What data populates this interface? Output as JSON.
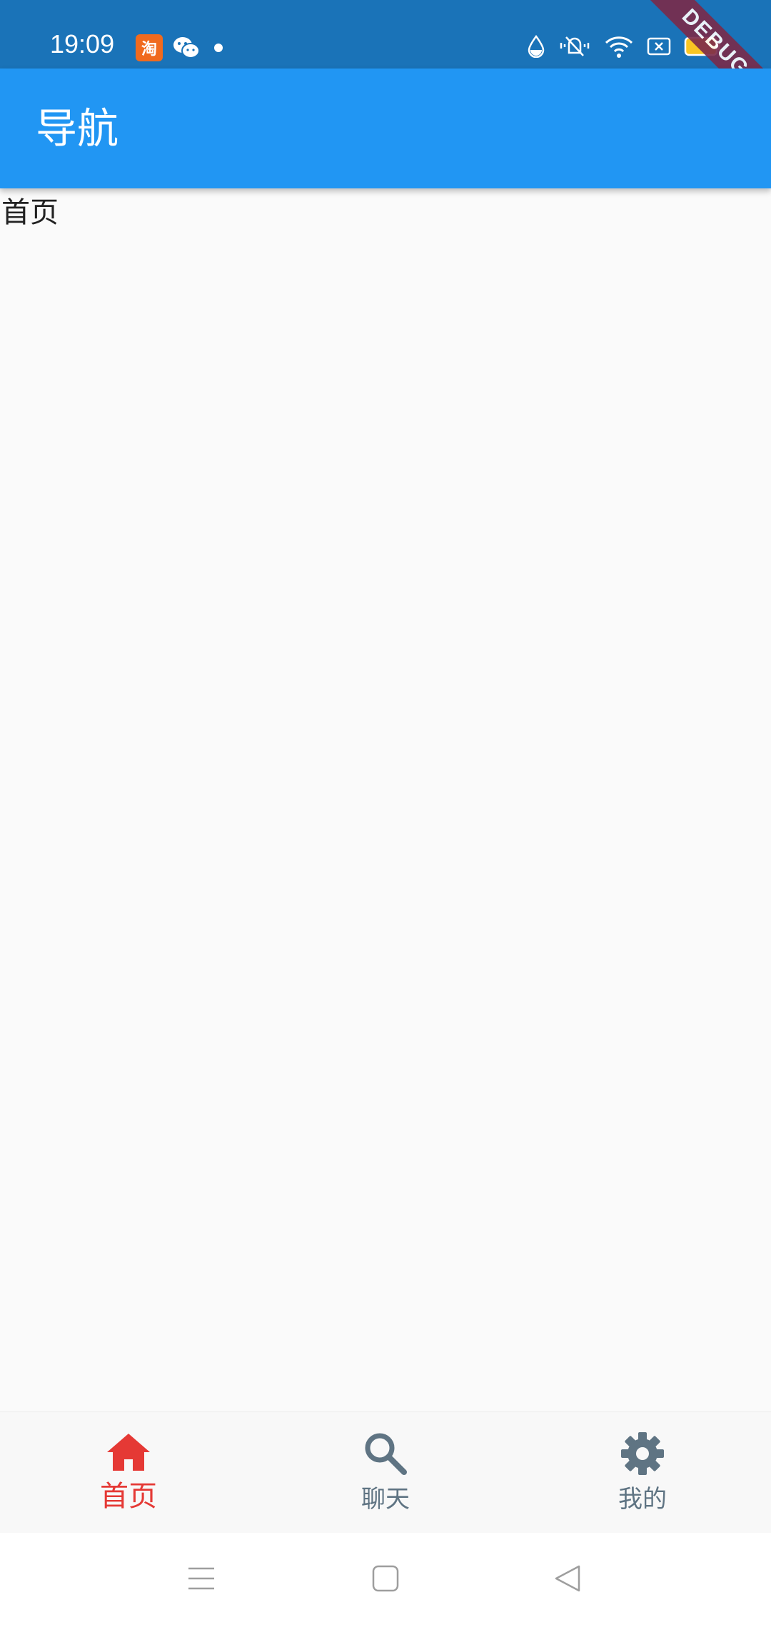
{
  "status_bar": {
    "time": "19:09",
    "left_icons": [
      "taobao-icon",
      "wechat-icon",
      "notification-dot-icon"
    ],
    "taobao_glyph": "淘",
    "right_icons": [
      "water-drop-icon",
      "bell-muted-icon",
      "wifi-icon",
      "sim-off-icon",
      "battery-icon"
    ],
    "background_color": "#1a73b8",
    "battery_color": "#f9c623"
  },
  "debug_banner": {
    "label": "DEBUG",
    "color": "#7b2a4a"
  },
  "app_bar": {
    "title": "导航",
    "color": "#2196f3"
  },
  "body": {
    "text": "首页"
  },
  "bottom_nav": {
    "active_color": "#e53935",
    "inactive_color": "#5f7483",
    "items": [
      {
        "label": "首页",
        "icon": "home-icon",
        "active": true
      },
      {
        "label": "聊天",
        "icon": "search-icon",
        "active": false
      },
      {
        "label": "我的",
        "icon": "gear-icon",
        "active": false
      }
    ]
  },
  "system_nav": {
    "buttons": [
      "menu-icon",
      "home-square-icon",
      "back-triangle-icon"
    ]
  }
}
